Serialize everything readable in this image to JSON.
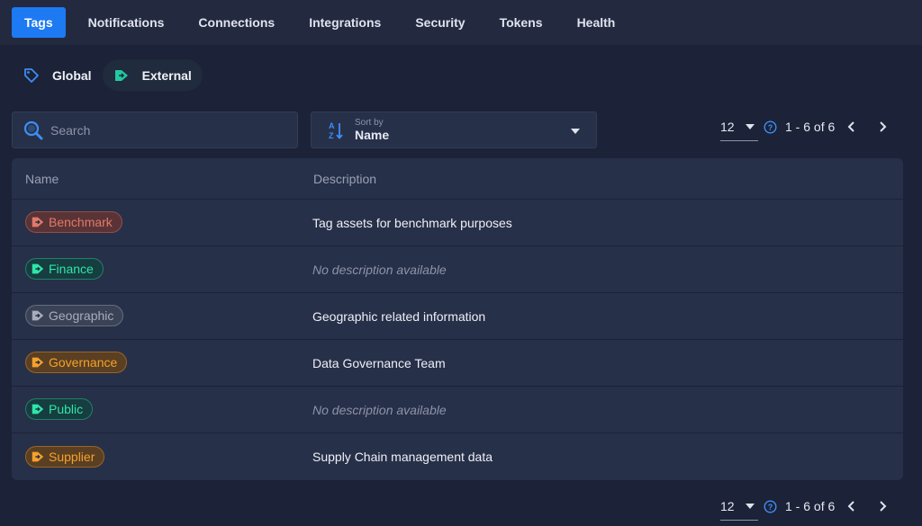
{
  "topnav": {
    "tabs": [
      {
        "label": "Tags",
        "active": true
      },
      {
        "label": "Notifications"
      },
      {
        "label": "Connections"
      },
      {
        "label": "Integrations"
      },
      {
        "label": "Security"
      },
      {
        "label": "Tokens"
      },
      {
        "label": "Health"
      }
    ]
  },
  "subtabs": [
    {
      "label": "Global",
      "icon": "tag-outline-icon"
    },
    {
      "label": "External",
      "icon": "external-tag-icon",
      "active": true
    }
  ],
  "search": {
    "placeholder": "Search",
    "value": ""
  },
  "sort": {
    "caption": "Sort by",
    "value": "Name"
  },
  "pager": {
    "page_size": "12",
    "range": "1 - 6 of 6"
  },
  "table": {
    "headers": {
      "name": "Name",
      "description": "Description"
    },
    "rows": [
      {
        "tag": "Benchmark",
        "description": "Tag assets for benchmark purposes",
        "color": "#e07a6a",
        "bg": "#5a3336",
        "empty": false
      },
      {
        "tag": "Finance",
        "description": "No description available",
        "color": "#2ee6a8",
        "bg": "#163d3f",
        "empty": true
      },
      {
        "tag": "Geographic",
        "description": "Geographic related information",
        "color": "#a8adbd",
        "bg": "#3a4256",
        "empty": false
      },
      {
        "tag": "Governance",
        "description": "Data Governance Team",
        "color": "#f5a12b",
        "bg": "#5a3f22",
        "empty": false
      },
      {
        "tag": "Public",
        "description": "No description available",
        "color": "#2ee6a8",
        "bg": "#163d3f",
        "empty": true
      },
      {
        "tag": "Supplier",
        "description": "Supply Chain management data",
        "color": "#f5a12b",
        "bg": "#5a3f22",
        "empty": false
      }
    ]
  },
  "colors": {
    "accent": "#1d7af2",
    "background": "#1c2237",
    "panel": "#273049"
  }
}
